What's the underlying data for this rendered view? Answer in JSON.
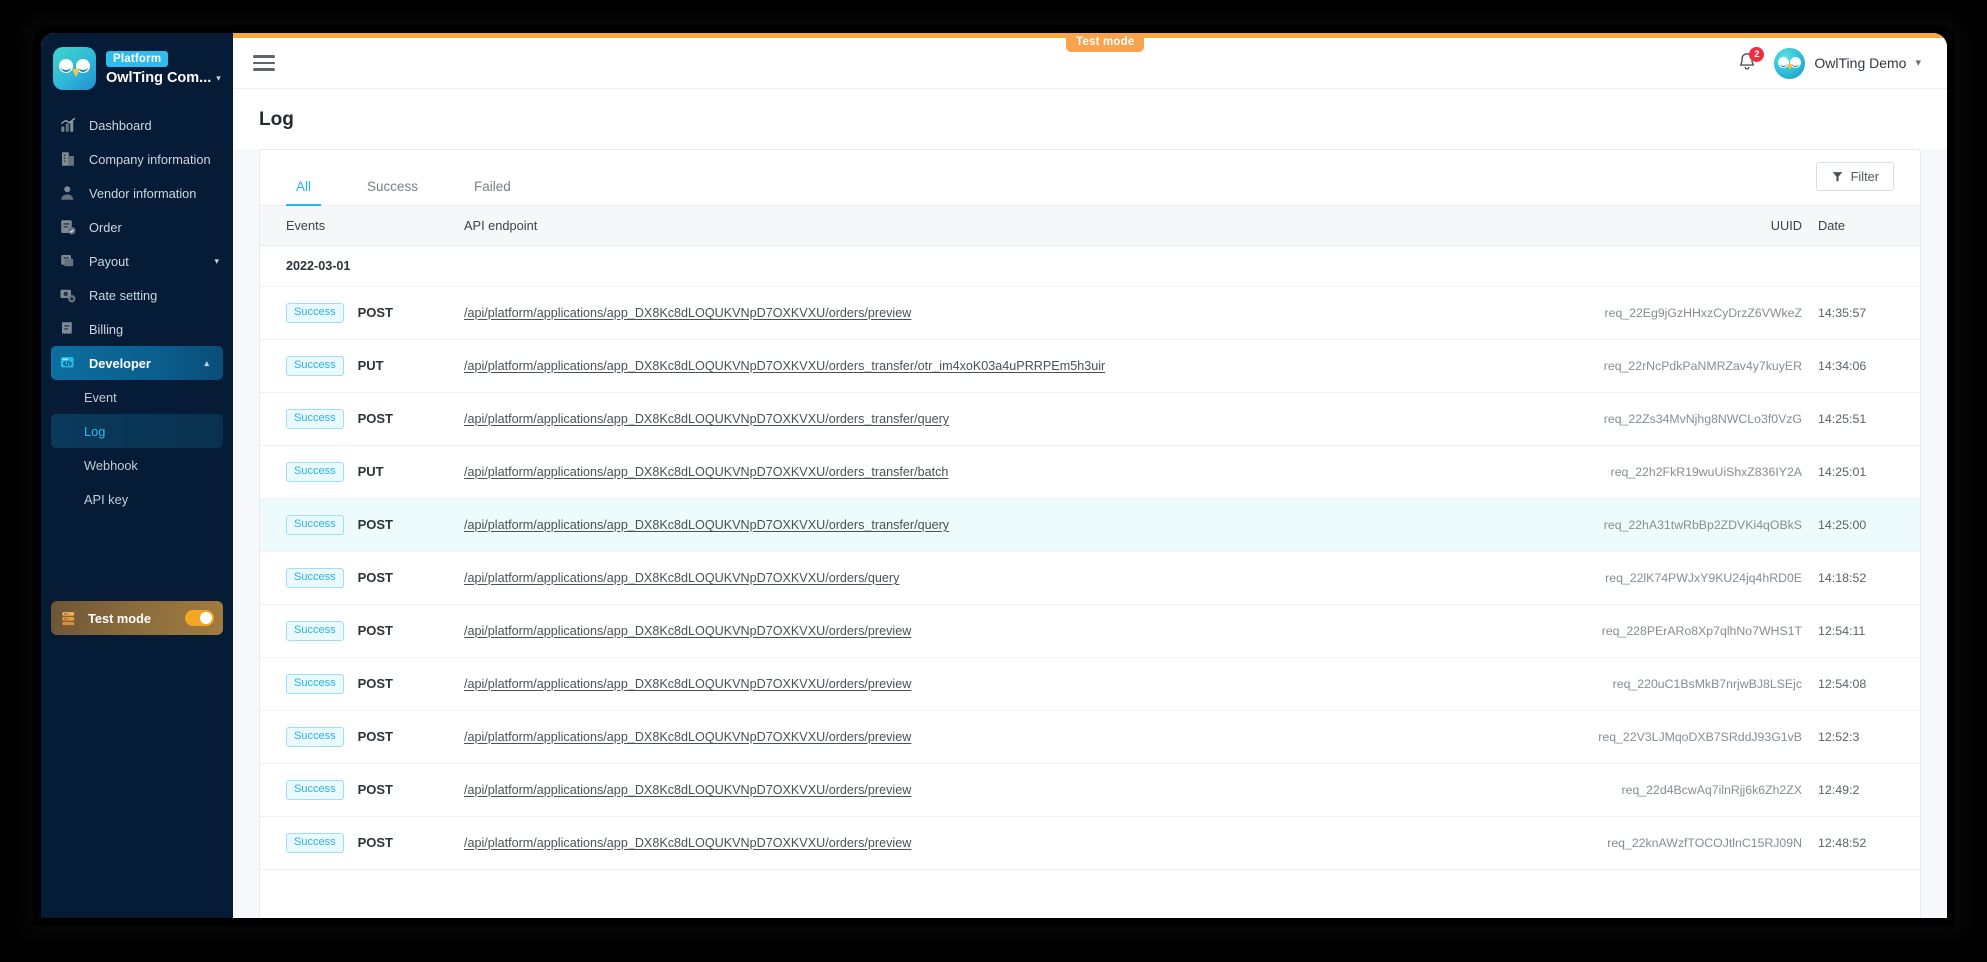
{
  "sidebar": {
    "brand": {
      "badge": "Platform",
      "name": "OwlTing Com...",
      "caret": "chevron-down"
    },
    "items": [
      {
        "label": "Dashboard",
        "icon": "dashboard-icon",
        "active": false,
        "caret": ""
      },
      {
        "label": "Company information",
        "icon": "building-icon",
        "active": false,
        "caret": ""
      },
      {
        "label": "Vendor information",
        "icon": "vendor-icon",
        "active": false,
        "caret": ""
      },
      {
        "label": "Order",
        "icon": "order-icon",
        "active": false,
        "caret": ""
      },
      {
        "label": "Payout",
        "icon": "payout-icon",
        "active": false,
        "caret": "chevron-down"
      },
      {
        "label": "Rate setting",
        "icon": "rate-icon",
        "active": false,
        "caret": ""
      },
      {
        "label": "Billing",
        "icon": "billing-icon",
        "active": false,
        "caret": ""
      },
      {
        "label": "Developer",
        "icon": "developer-icon",
        "active": true,
        "caret": "chevron-up"
      }
    ],
    "sub_items": [
      {
        "label": "Event",
        "active": false
      },
      {
        "label": "Log",
        "active": true
      },
      {
        "label": "Webhook",
        "active": false
      },
      {
        "label": "API key",
        "active": false
      }
    ],
    "test_mode": {
      "label": "Test mode",
      "enabled": true,
      "icon": "server-icon"
    }
  },
  "topbar": {
    "menu_icon": "hamburger-icon",
    "test_mode_pill": "Test mode",
    "bell_icon": "bell-icon",
    "notification_count": "2",
    "user_name": "OwlTing Demo",
    "user_caret": "chevron-down"
  },
  "page": {
    "title": "Log"
  },
  "tabs": [
    {
      "label": "All",
      "active": true
    },
    {
      "label": "Success",
      "active": false
    },
    {
      "label": "Failed",
      "active": false
    }
  ],
  "filter_button": {
    "label": "Filter",
    "icon": "funnel-icon"
  },
  "table": {
    "columns": [
      "Events",
      "API endpoint",
      "UUID",
      "Date"
    ],
    "group_label": "2022-03-01",
    "rows": [
      {
        "status": "Success",
        "method": "POST",
        "endpoint": "/api/platform/applications/app_DX8Kc8dLOQUKVNpD7OXKVXU/orders/preview",
        "uuid": "req_22Eg9jGzHHxzCyDrzZ6VWkeZ",
        "date": "14:35:57",
        "highlight": false
      },
      {
        "status": "Success",
        "method": "PUT",
        "endpoint": "/api/platform/applications/app_DX8Kc8dLOQUKVNpD7OXKVXU/orders_transfer/otr_im4xoK03a4uPRRPEm5h3uir",
        "uuid": "req_22rNcPdkPaNMRZav4y7kuyER",
        "date": "14:34:06",
        "highlight": false
      },
      {
        "status": "Success",
        "method": "POST",
        "endpoint": "/api/platform/applications/app_DX8Kc8dLOQUKVNpD7OXKVXU/orders_transfer/query",
        "uuid": "req_22Zs34MvNjhg8NWCLo3f0VzG",
        "date": "14:25:51",
        "highlight": false
      },
      {
        "status": "Success",
        "method": "PUT",
        "endpoint": "/api/platform/applications/app_DX8Kc8dLOQUKVNpD7OXKVXU/orders_transfer/batch",
        "uuid": "req_22h2FkR19wuUiShxZ836IY2A",
        "date": "14:25:01",
        "highlight": false
      },
      {
        "status": "Success",
        "method": "POST",
        "endpoint": "/api/platform/applications/app_DX8Kc8dLOQUKVNpD7OXKVXU/orders_transfer/query",
        "uuid": "req_22hA31twRbBp2ZDVKi4qOBkS",
        "date": "14:25:00",
        "highlight": true
      },
      {
        "status": "Success",
        "method": "POST",
        "endpoint": "/api/platform/applications/app_DX8Kc8dLOQUKVNpD7OXKVXU/orders/query",
        "uuid": "req_22lK74PWJxY9KU24jq4hRD0E",
        "date": "14:18:52",
        "highlight": false
      },
      {
        "status": "Success",
        "method": "POST",
        "endpoint": "/api/platform/applications/app_DX8Kc8dLOQUKVNpD7OXKVXU/orders/preview",
        "uuid": "req_228PErARo8Xp7qlhNo7WHS1T",
        "date": "12:54:11",
        "highlight": false
      },
      {
        "status": "Success",
        "method": "POST",
        "endpoint": "/api/platform/applications/app_DX8Kc8dLOQUKVNpD7OXKVXU/orders/preview",
        "uuid": "req_220uC1BsMkB7nrjwBJ8LSEjc",
        "date": "12:54:08",
        "highlight": false
      },
      {
        "status": "Success",
        "method": "POST",
        "endpoint": "/api/platform/applications/app_DX8Kc8dLOQUKVNpD7OXKVXU/orders/preview",
        "uuid": "req_22V3LJMqoDXB7SRddJ93G1vB",
        "date": "12:52:3",
        "highlight": false
      },
      {
        "status": "Success",
        "method": "POST",
        "endpoint": "/api/platform/applications/app_DX8Kc8dLOQUKVNpD7OXKVXU/orders/preview",
        "uuid": "req_22d4BcwAq7ilnRjj6k6Zh2ZX",
        "date": "12:49:2",
        "highlight": false
      },
      {
        "status": "Success",
        "method": "POST",
        "endpoint": "/api/platform/applications/app_DX8Kc8dLOQUKVNpD7OXKVXU/orders/preview",
        "uuid": "req_22knAWzfTOCOJtlnC15RJ09N",
        "date": "12:48:52",
        "highlight": false
      }
    ]
  },
  "colors": {
    "sidebar_bg": "#061c36",
    "accent_cyan": "#22b8ea",
    "accent_orange": "#f6a93b",
    "badge_red": "#ee2d41",
    "row_highlight": "#edfbfd"
  }
}
